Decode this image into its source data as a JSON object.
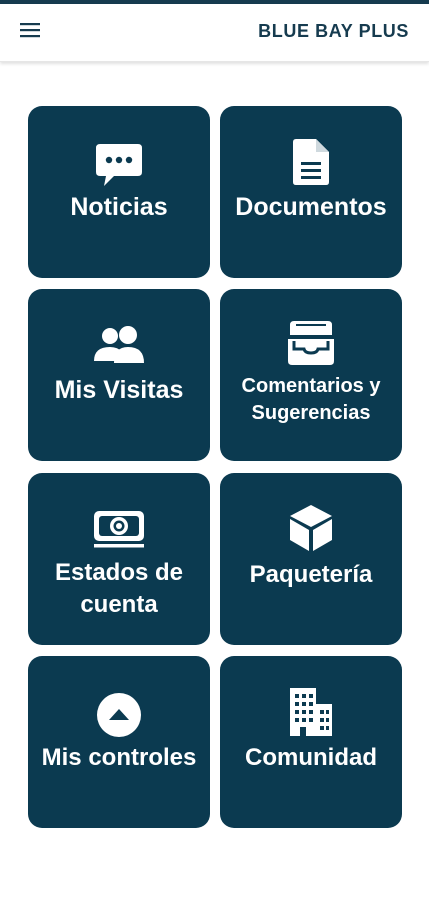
{
  "header": {
    "title": "BLUE BAY PLUS",
    "menu_icon": "hamburger-menu-icon",
    "bar_color": "#163b4f"
  },
  "tiles": [
    {
      "label": "Noticias",
      "icon": "chat-bubble-icon"
    },
    {
      "label": "Documentos",
      "icon": "document-icon"
    },
    {
      "label": "Mis Visitas",
      "icon": "users-icon"
    },
    {
      "label": "Comentarios y Sugerencias",
      "line1": "Comentarios y",
      "line2": "Sugerencias",
      "icon": "inbox-tray-icon"
    },
    {
      "label": "Estados de cuenta",
      "line1": "Estados de",
      "line2": "cuenta",
      "icon": "money-bill-icon"
    },
    {
      "label": "Paquetería",
      "icon": "package-box-icon"
    },
    {
      "label": "Mis controles",
      "icon": "arrow-up-circle-icon"
    },
    {
      "label": "Comunidad",
      "icon": "buildings-icon"
    }
  ],
  "colors": {
    "tile_bg": "#0b3a50",
    "tile_text": "#ffffff",
    "background": "#ffffff"
  }
}
